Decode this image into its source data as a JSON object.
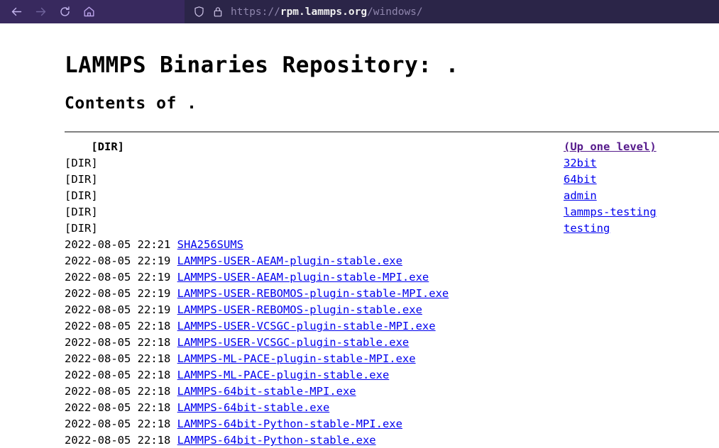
{
  "browser": {
    "nav": {
      "back_label": "Back",
      "forward_label": "Forward",
      "reload_label": "Reload",
      "home_label": "Home"
    },
    "urlbar": {
      "scheme": "https://",
      "host": "rpm.lammps.org",
      "path": "/windows/",
      "shield_label": "Tracking protection",
      "lock_label": "Connection secure"
    },
    "colors": {
      "toolbar_bg": "#38295e",
      "urlbar_bg": "#2b2548",
      "icon": "#c4b5ee"
    }
  },
  "page": {
    "title": "LAMMPS Binaries Repository: .",
    "subtitle": "Contents of .",
    "colors": {
      "link": "#0000ee",
      "visited_link": "#551a8b",
      "rule": "#808080"
    },
    "entries": [
      {
        "meta": "    [DIR]",
        "meta_bold": true,
        "name": "(Up one level)",
        "visited": true
      },
      {
        "meta": "[DIR]",
        "meta_bold": false,
        "name": "32bit",
        "visited": false
      },
      {
        "meta": "[DIR]",
        "meta_bold": false,
        "name": "64bit",
        "visited": false
      },
      {
        "meta": "[DIR]",
        "meta_bold": false,
        "name": "admin",
        "visited": false
      },
      {
        "meta": "[DIR]",
        "meta_bold": false,
        "name": "lammps-testing",
        "visited": false
      },
      {
        "meta": "[DIR]",
        "meta_bold": false,
        "name": "testing",
        "visited": false
      },
      {
        "meta": "2022-08-05 22:21",
        "meta_bold": false,
        "name": "SHA256SUMS",
        "visited": false,
        "inline": true
      },
      {
        "meta": "2022-08-05 22:19",
        "meta_bold": false,
        "name": "LAMMPS-USER-AEAM-plugin-stable.exe",
        "visited": false,
        "inline": true
      },
      {
        "meta": "2022-08-05 22:19",
        "meta_bold": false,
        "name": "LAMMPS-USER-AEAM-plugin-stable-MPI.exe",
        "visited": false,
        "inline": true
      },
      {
        "meta": "2022-08-05 22:19",
        "meta_bold": false,
        "name": "LAMMPS-USER-REBOMOS-plugin-stable-MPI.exe",
        "visited": false,
        "inline": true
      },
      {
        "meta": "2022-08-05 22:19",
        "meta_bold": false,
        "name": "LAMMPS-USER-REBOMOS-plugin-stable.exe",
        "visited": false,
        "inline": true
      },
      {
        "meta": "2022-08-05 22:18",
        "meta_bold": false,
        "name": "LAMMPS-USER-VCSGC-plugin-stable-MPI.exe",
        "visited": false,
        "inline": true
      },
      {
        "meta": "2022-08-05 22:18",
        "meta_bold": false,
        "name": "LAMMPS-USER-VCSGC-plugin-stable.exe",
        "visited": false,
        "inline": true
      },
      {
        "meta": "2022-08-05 22:18",
        "meta_bold": false,
        "name": "LAMMPS-ML-PACE-plugin-stable-MPI.exe",
        "visited": false,
        "inline": true
      },
      {
        "meta": "2022-08-05 22:18",
        "meta_bold": false,
        "name": "LAMMPS-ML-PACE-plugin-stable.exe",
        "visited": false,
        "inline": true
      },
      {
        "meta": "2022-08-05 22:18",
        "meta_bold": false,
        "name": "LAMMPS-64bit-stable-MPI.exe",
        "visited": false,
        "inline": true
      },
      {
        "meta": "2022-08-05 22:18",
        "meta_bold": false,
        "name": "LAMMPS-64bit-stable.exe",
        "visited": false,
        "inline": true
      },
      {
        "meta": "2022-08-05 22:18",
        "meta_bold": false,
        "name": "LAMMPS-64bit-Python-stable-MPI.exe",
        "visited": false,
        "inline": true
      },
      {
        "meta": "2022-08-05 22:18",
        "meta_bold": false,
        "name": "LAMMPS-64bit-Python-stable.exe",
        "visited": false,
        "inline": true
      }
    ]
  }
}
